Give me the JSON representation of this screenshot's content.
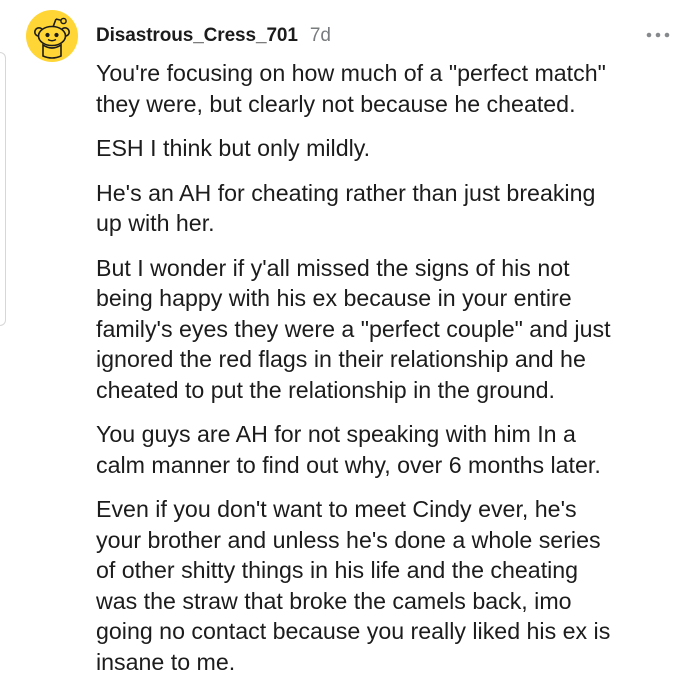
{
  "comment": {
    "username": "Disastrous_Cress_701",
    "timestamp": "7d",
    "avatar_icon": "snoo-avatar-icon",
    "more_icon": "more-options-icon",
    "accent_color": "#FFD635",
    "paragraphs": [
      "You're focusing on how much of a \"perfect match\"\nthey were, but clearly not because he cheated.",
      "ESH I think but only mildly.",
      "He's an AH for cheating rather than just breaking\nup with her.",
      "But I wonder if y'all missed the signs of his not\nbeing happy with his ex because in your entire\nfamily's eyes they were a \"perfect couple\" and just\nignored the red flags in their relationship and he\ncheated to put the relationship in the ground.",
      "You guys are AH for not speaking with him In a\ncalm manner to find out why, over 6 months later.",
      "Even if you don't want to meet Cindy ever, he's\nyour brother and unless he's done a whole series\nof other shitty things in his life and the cheating\nwas the straw that broke the camels back, imo\ngoing no contact because you really liked his ex is\ninsane to me."
    ]
  }
}
